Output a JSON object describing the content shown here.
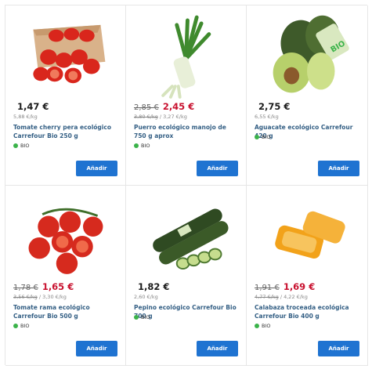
{
  "products": [
    {
      "price": "1,47 €",
      "old_price": "",
      "unit_old": "",
      "unit_price": "5,88 €/kg",
      "title": "Tomate cherry pera ecológico Carrefour Bio 250 g",
      "badge": "BIO",
      "button": "Añadir",
      "image_icon": "cherry-tomatoes-icon"
    },
    {
      "price": "2,45 €",
      "old_price": "2,85 €",
      "unit_old": "3,80 €/kg",
      "unit_price": "3,27 €/kg",
      "title": "Puerro ecológico manojo de 750 g aprox",
      "badge": "BIO",
      "button": "Añadir",
      "image_icon": "leek-icon"
    },
    {
      "price": "2,75 €",
      "old_price": "",
      "unit_old": "",
      "unit_price": "6,55 €/kg",
      "title": "Aguacate ecológico Carrefour 420 g",
      "badge": "BIO",
      "button": "Añadir",
      "image_icon": "avocado-icon",
      "image_tag": "BIO"
    },
    {
      "price": "1,65 €",
      "old_price": "1,78 €",
      "unit_old": "3,56 €/kg",
      "unit_price": "3,30 €/kg",
      "title": "Tomate rama ecológico Carrefour Bio 500 g",
      "badge": "BIO",
      "button": "Añadir",
      "image_icon": "vine-tomatoes-icon"
    },
    {
      "price": "1,82 €",
      "old_price": "",
      "unit_old": "",
      "unit_price": "2,60 €/kg",
      "title": "Pepino ecológico Carrefour Bio 700 g",
      "badge": "BIO",
      "button": "Añadir",
      "image_icon": "cucumber-icon"
    },
    {
      "price": "1,69 €",
      "old_price": "1,91 €",
      "unit_old": "4,77 €/kg",
      "unit_price": "4,22 €/kg",
      "title": "Calabaza troceada ecológica Carrefour Bio 400 g",
      "badge": "BIO",
      "button": "Añadir",
      "image_icon": "squash-pieces-icon"
    }
  ],
  "colors": {
    "sale_price": "#c8102e",
    "title_link": "#356085",
    "button_bg": "#1f73d1",
    "bio_dot": "#3bb34a"
  }
}
